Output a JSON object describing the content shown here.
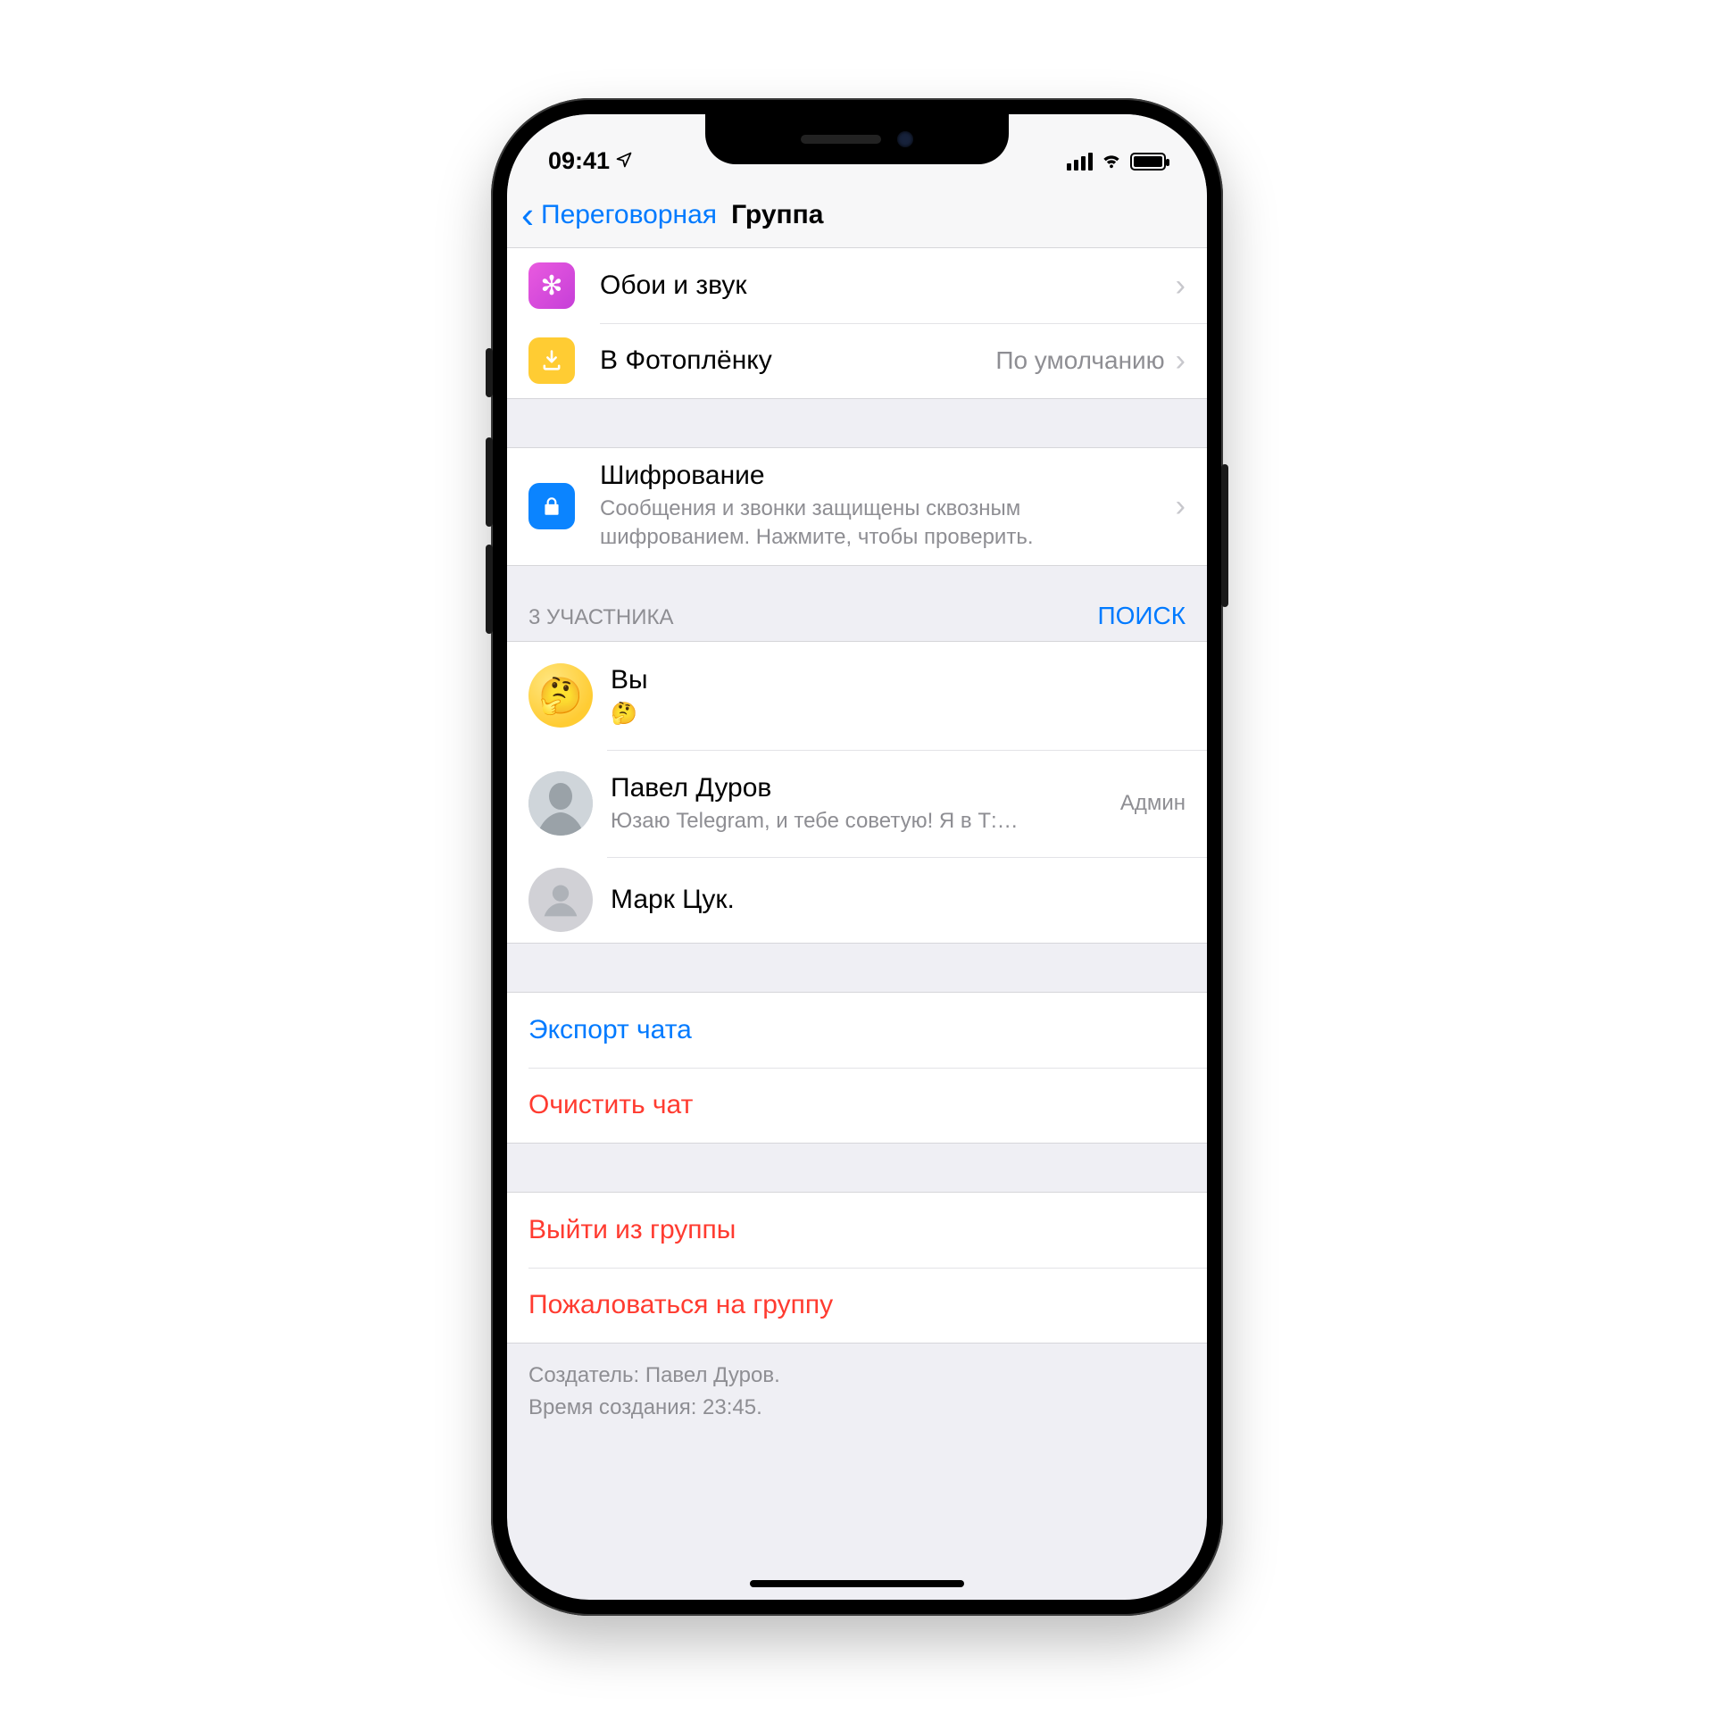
{
  "status": {
    "time": "09:41"
  },
  "nav": {
    "back": "Переговорная",
    "title": "Группа"
  },
  "rows": {
    "wallpaper": "Обои и звук",
    "save_to_roll": "В Фотоплёнку",
    "save_to_roll_value": "По умолчанию",
    "encryption_title": "Шифрование",
    "encryption_sub": "Сообщения и звонки защищены сквозным шифрованием. Нажмите, чтобы проверить."
  },
  "members_header": {
    "count": "3 УЧАСТНИКА",
    "search": "ПОИСК"
  },
  "members": [
    {
      "name": "Вы",
      "status": "🤔",
      "role": "",
      "avatar": "emoji"
    },
    {
      "name": "Павел Дуров",
      "status": "Юзаю Telegram, и тебе советую! Я в Т:…",
      "role": "Админ",
      "avatar": "photo"
    },
    {
      "name": "Марк Цук.",
      "status": "",
      "role": "",
      "avatar": "blank"
    }
  ],
  "actions": {
    "export": "Экспорт чата",
    "clear": "Очистить чат",
    "leave": "Выйти из группы",
    "report": "Пожаловаться на группу"
  },
  "footer": {
    "creator": "Создатель: Павел Дуров.",
    "created_at": "Время создания: 23:45."
  }
}
